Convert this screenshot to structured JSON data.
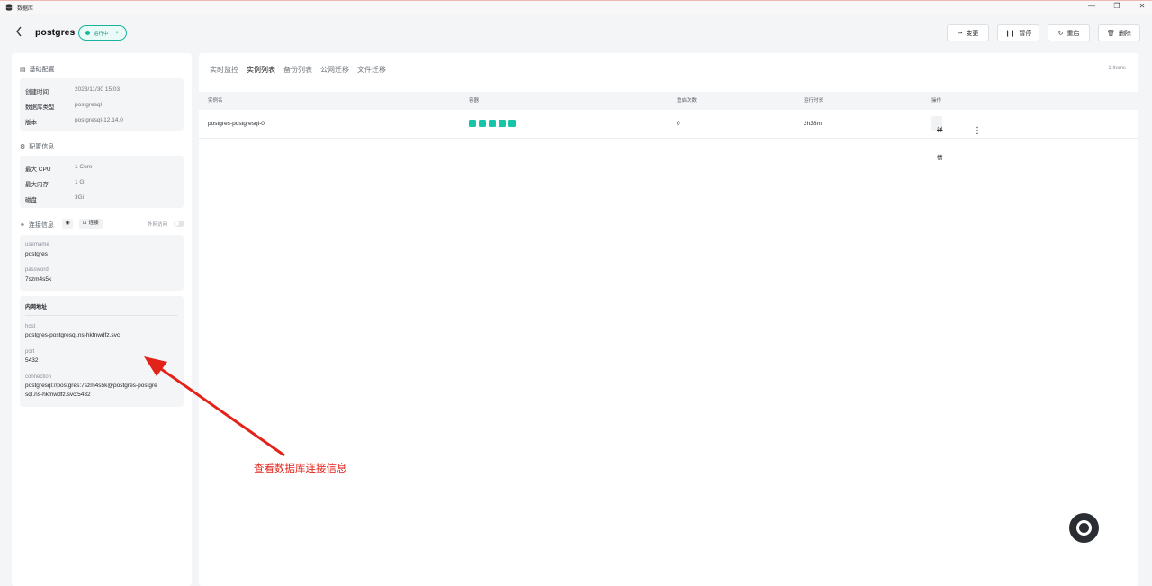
{
  "window": {
    "title": "数据库",
    "controls": [
      "—",
      "❐",
      "✕"
    ]
  },
  "header": {
    "db_name": "postgres",
    "status": "运行中",
    "actions": [
      {
        "icon": "edit-icon",
        "glyph": "⇀",
        "label": "变更"
      },
      {
        "icon": "pause-icon",
        "glyph": "❙❙",
        "label": "暂停"
      },
      {
        "icon": "restart-icon",
        "glyph": "↻",
        "label": "重启"
      },
      {
        "icon": "trash-icon",
        "glyph": "🗑",
        "label": "删除"
      }
    ]
  },
  "basic": {
    "title": "基础配置",
    "rows": [
      {
        "k": "创建时间",
        "v": "2023/11/30 15:03"
      },
      {
        "k": "数据库类型",
        "v": "postgresql"
      },
      {
        "k": "版本",
        "v": "postgresql-12.14.0"
      }
    ]
  },
  "config": {
    "title": "配置信息",
    "rows": [
      {
        "k": "最大 CPU",
        "v": "1 Core"
      },
      {
        "k": "最大内存",
        "v": "1 Gi"
      },
      {
        "k": "磁盘",
        "v": "3Gi"
      }
    ]
  },
  "connection": {
    "title": "连接信息",
    "connect_label": "连接",
    "external_label": "外网访问",
    "external_enabled": false,
    "username_label": "username",
    "username": "postgres",
    "password_label": "password",
    "password": "7szm4s5k"
  },
  "internal": {
    "title": "内网地址",
    "host_label": "host",
    "host": "postgres-postgresql.ns-hkfnwdfz.svc",
    "port_label": "port",
    "port": "5432",
    "connection_label": "connection",
    "connection": "postgresql://postgres:7szm4s5k@postgres-postgresql.ns-hkfnwdfz.svc:5432"
  },
  "main": {
    "tabs": [
      "实时监控",
      "实例列表",
      "备份列表",
      "公网迁移",
      "文件迁移"
    ],
    "active_tab": 1,
    "items_count": "1 Items",
    "columns": [
      "实例名",
      "容器",
      "重启次数",
      "运行时长",
      "操作"
    ],
    "rows": [
      {
        "name": "postgres-postgresql-0",
        "containers": 5,
        "restarts": "0",
        "uptime": "2h38m",
        "detail_label": "详情"
      }
    ]
  },
  "annotation": {
    "text": "查看数据库连接信息",
    "color": "#e2231a"
  },
  "colors": {
    "accent": "#16c5a8",
    "status": "#16b89f",
    "annotation": "#e2231a"
  }
}
